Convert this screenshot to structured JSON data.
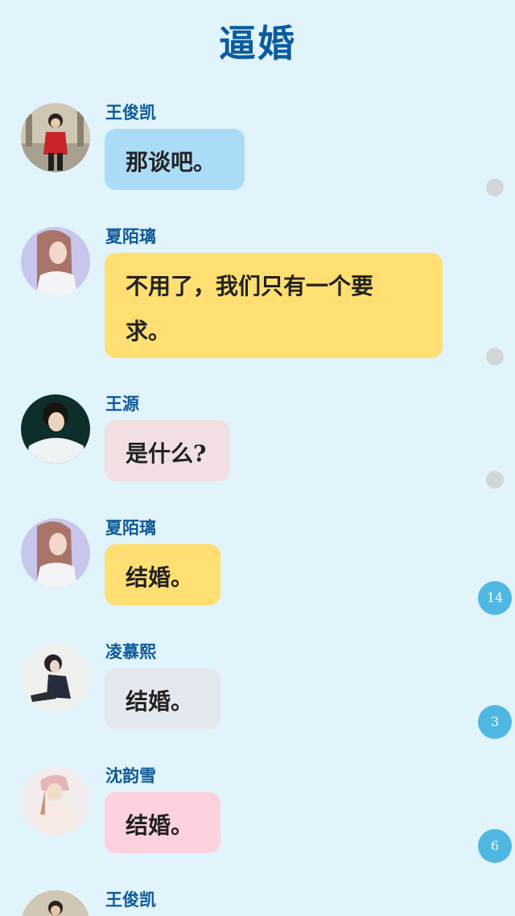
{
  "title": "逼婚",
  "messages": [
    {
      "name": "王俊凯",
      "text": "那谈吧。",
      "bubble_color": "#aadcf8"
    },
    {
      "name": "夏陌璃",
      "text": "不用了，我们只有一个要求。",
      "bubble_color": "#ffdf72"
    },
    {
      "name": "王源",
      "text": "是什么?",
      "bubble_color": "#f1dfe1"
    },
    {
      "name": "夏陌璃",
      "text": "结婚。",
      "bubble_color": "#ffdf72"
    },
    {
      "name": "凌慕熙",
      "text": "结婚。",
      "bubble_color": "#e3e8ee"
    },
    {
      "name": "沈韵雪",
      "text": "结婚。",
      "bubble_color": "#fdd1dd"
    },
    {
      "name": "王俊凯",
      "text": "",
      "bubble_color": "#aadcf8"
    }
  ],
  "badges": [
    {
      "count": "14"
    },
    {
      "count": "3"
    },
    {
      "count": "6"
    }
  ],
  "colors": {
    "background": "#e1f3fb",
    "title": "#0b5c9e",
    "name": "#0d5a97",
    "badge": "#4fb7e2",
    "dot": "#d3d6d8"
  }
}
